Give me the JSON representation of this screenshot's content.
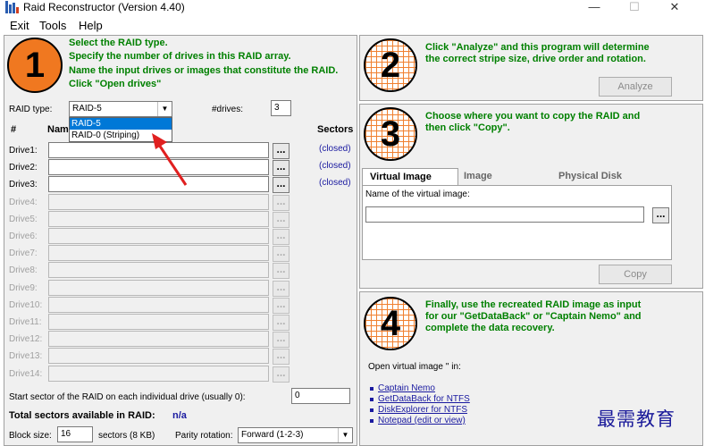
{
  "window": {
    "title": "Raid Reconstructor (Version 4.40)",
    "minimize": "—",
    "maximize": "☐",
    "close": "✕"
  },
  "menu": [
    {
      "label": "Exit"
    },
    {
      "label": "Tools"
    },
    {
      "label": "Help"
    }
  ],
  "step1": {
    "number": "1",
    "lines": [
      "Select the RAID type.",
      "Specify the number of drives in this RAID array.",
      "Name the input drives or images that constitute the RAID.",
      "Click \"Open drives\""
    ]
  },
  "raid": {
    "type_label": "RAID type:",
    "type_value": "RAID-5",
    "options": [
      "RAID-5",
      "RAID-0 (Striping)"
    ],
    "drives_label": "#drives:",
    "drives_value": "3"
  },
  "table": {
    "col_hash": "#",
    "col_name": "Nam",
    "col_sectors": "Sectors"
  },
  "drives": [
    {
      "label": "Drive1:",
      "status": "(closed)",
      "enabled": true
    },
    {
      "label": "Drive2:",
      "status": "(closed)",
      "enabled": true
    },
    {
      "label": "Drive3:",
      "status": "(closed)",
      "enabled": true
    },
    {
      "label": "Drive4:",
      "status": "",
      "enabled": false
    },
    {
      "label": "Drive5:",
      "status": "",
      "enabled": false
    },
    {
      "label": "Drive6:",
      "status": "",
      "enabled": false
    },
    {
      "label": "Drive7:",
      "status": "",
      "enabled": false
    },
    {
      "label": "Drive8:",
      "status": "",
      "enabled": false
    },
    {
      "label": "Drive9:",
      "status": "",
      "enabled": false
    },
    {
      "label": "Drive10:",
      "status": "",
      "enabled": false
    },
    {
      "label": "Drive11:",
      "status": "",
      "enabled": false
    },
    {
      "label": "Drive12:",
      "status": "",
      "enabled": false
    },
    {
      "label": "Drive13:",
      "status": "",
      "enabled": false
    },
    {
      "label": "Drive14:",
      "status": "",
      "enabled": false
    }
  ],
  "browse_label": "...",
  "start_sector": {
    "label": "Start sector of the RAID on each individual drive (usually 0):",
    "value": "0"
  },
  "total": {
    "label": "Total sectors available in RAID:",
    "value": "n/a"
  },
  "block": {
    "label": "Block size:",
    "value": "16",
    "unit": "sectors (8 KB)",
    "parity_label": "Parity rotation:",
    "parity_value": "Forward (1-2-3)"
  },
  "step2": {
    "number": "2",
    "lines": [
      "Click \"Analyze\" and this program will determine",
      "the correct stripe size, drive order and rotation."
    ],
    "button": "Analyze"
  },
  "step3": {
    "number": "3",
    "lines": [
      "Choose where you want to copy the RAID and",
      "then click \"Copy\"."
    ],
    "tabs": [
      "Virtual Image",
      "Image",
      "Physical Disk"
    ],
    "name_label": "Name of the virtual image:",
    "name_value": "",
    "button": "Copy"
  },
  "step4": {
    "number": "4",
    "lines": [
      "Finally, use the recreated RAID image as input",
      "for our \"GetDataBack\" or \"Captain Nemo\" and",
      "complete the data recovery."
    ],
    "open_label": "Open virtual image '' in:",
    "links": [
      "Captain Nemo",
      "GetDataBack for NTFS",
      "DiskExplorer for NTFS",
      "Notepad (edit or view)"
    ]
  },
  "watermark": "最需教育",
  "colors": {
    "accent_orange": "#f07820",
    "instruction_green": "#008000",
    "link_blue": "#1a1aa0",
    "annotation_red": "#e02020"
  }
}
